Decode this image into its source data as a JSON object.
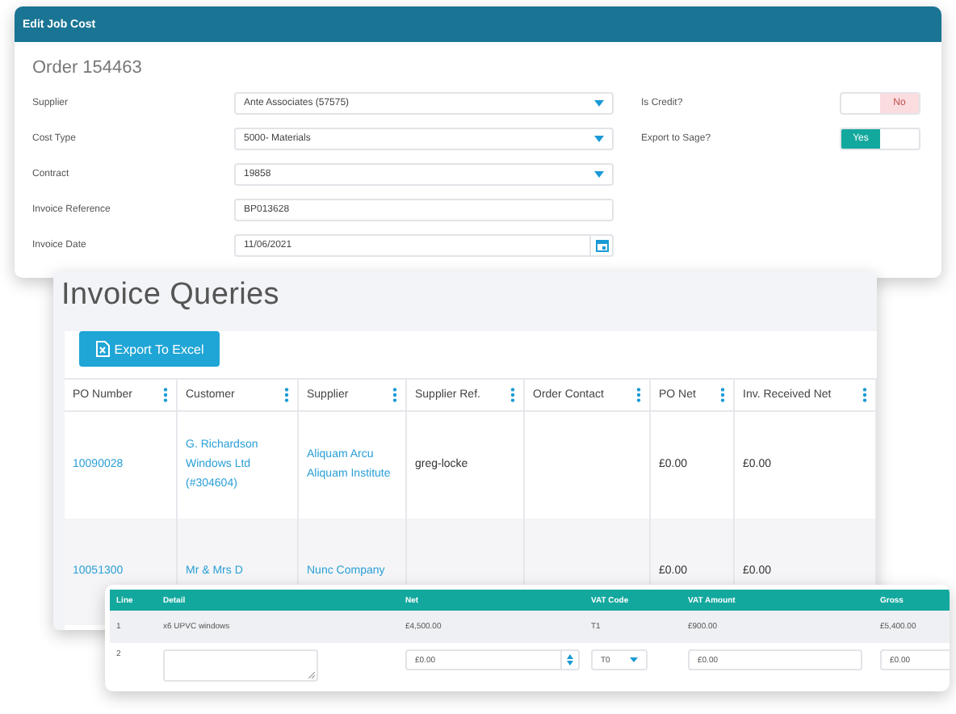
{
  "edit_job_cost": {
    "title": "Edit Job Cost",
    "heading": "Order 154463",
    "fields": [
      {
        "label": "Supplier",
        "kind": "select",
        "value": "Ante Associates (57575)"
      },
      {
        "label": "Cost Type",
        "kind": "select",
        "value": "5000- Materials"
      },
      {
        "label": "Contract",
        "kind": "select",
        "value": "19858"
      },
      {
        "label": "Invoice Reference",
        "kind": "text",
        "value": "BP013628"
      },
      {
        "label": "Invoice Date",
        "kind": "date",
        "value": "11/06/2021"
      }
    ],
    "toggles": [
      {
        "label": "Is Credit?",
        "on": false,
        "text": "No"
      },
      {
        "label": "Export to Sage?",
        "on": true,
        "text": "Yes"
      }
    ]
  },
  "invoice_queries": {
    "title": "Invoice Queries",
    "export_button": "Export To Excel",
    "columns": [
      "PO Number",
      "Customer",
      "Supplier",
      "Supplier Ref.",
      "Order Contact",
      "PO Net",
      "Inv. Received Net"
    ],
    "rows": [
      {
        "cells": [
          {
            "kind": "link",
            "text": "10090028"
          },
          {
            "kind": "link",
            "text": "G. Richardson Windows Ltd (#304604)"
          },
          {
            "kind": "link",
            "text": "Aliquam Arcu Aliquam Institute"
          },
          {
            "kind": "text",
            "text": "greg-locke"
          },
          {
            "kind": "empty"
          },
          {
            "kind": "text",
            "text": "£0.00"
          },
          {
            "kind": "text",
            "text": "£0.00"
          }
        ]
      },
      {
        "cells": [
          {
            "kind": "link",
            "text": "10051300"
          },
          {
            "kind": "link",
            "text": "Mr & Mrs D"
          },
          {
            "kind": "link",
            "text": "Nunc Company"
          },
          {
            "kind": "empty"
          },
          {
            "kind": "empty"
          },
          {
            "kind": "text",
            "text": "£0.00"
          },
          {
            "kind": "text",
            "text": "£0.00"
          }
        ]
      }
    ]
  },
  "line_items": {
    "columns": [
      "Line",
      "Detail",
      "Net",
      "VAT Code",
      "VAT Amount",
      "Gross"
    ],
    "rows": [
      {
        "cells": [
          {
            "kind": "text",
            "text": "1"
          },
          {
            "kind": "text",
            "text": "x6 UPVC windows"
          },
          {
            "kind": "text",
            "text": "£4,500.00"
          },
          {
            "kind": "text",
            "text": "T1"
          },
          {
            "kind": "text",
            "text": "£900.00"
          },
          {
            "kind": "text",
            "text": "£5,400.00"
          }
        ]
      },
      {
        "cells": [
          {
            "kind": "text",
            "text": "2"
          },
          {
            "kind": "textarea"
          },
          {
            "kind": "number",
            "value": "£0.00"
          },
          {
            "kind": "select",
            "value": "T0"
          },
          {
            "kind": "input",
            "value": "£0.00"
          },
          {
            "kind": "input",
            "value": "£0.00"
          }
        ]
      }
    ]
  }
}
